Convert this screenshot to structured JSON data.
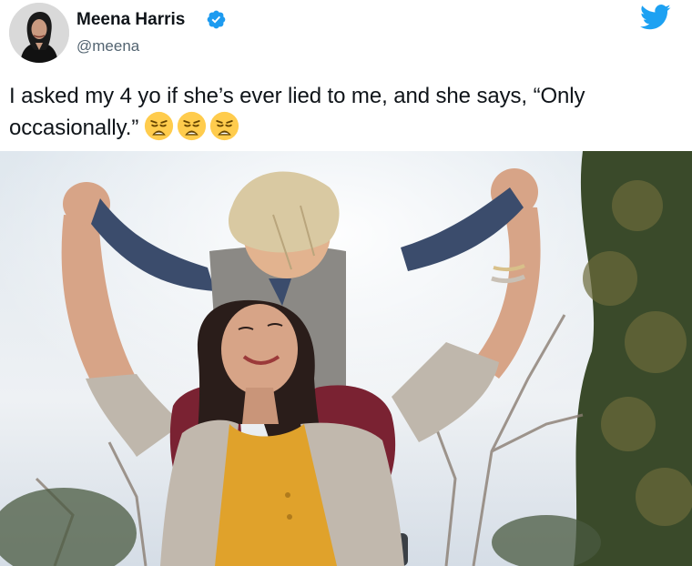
{
  "tweet": {
    "author_name": "Meena Harris",
    "author_handle": "@meena",
    "text": "I asked my 4 yo if she’s ever lied to me, and she says, “Only occasionally.”",
    "emoji": [
      "weary-face-emoji",
      "weary-face-emoji",
      "weary-face-emoji"
    ]
  },
  "icons": {
    "verified": "verified-badge-icon",
    "platform": "twitter-bird-icon"
  },
  "colors": {
    "verified_blue": "#1d9bf0",
    "twitter_blue": "#1da1f2",
    "handle_gray": "#536471",
    "text": "#0f1419"
  }
}
